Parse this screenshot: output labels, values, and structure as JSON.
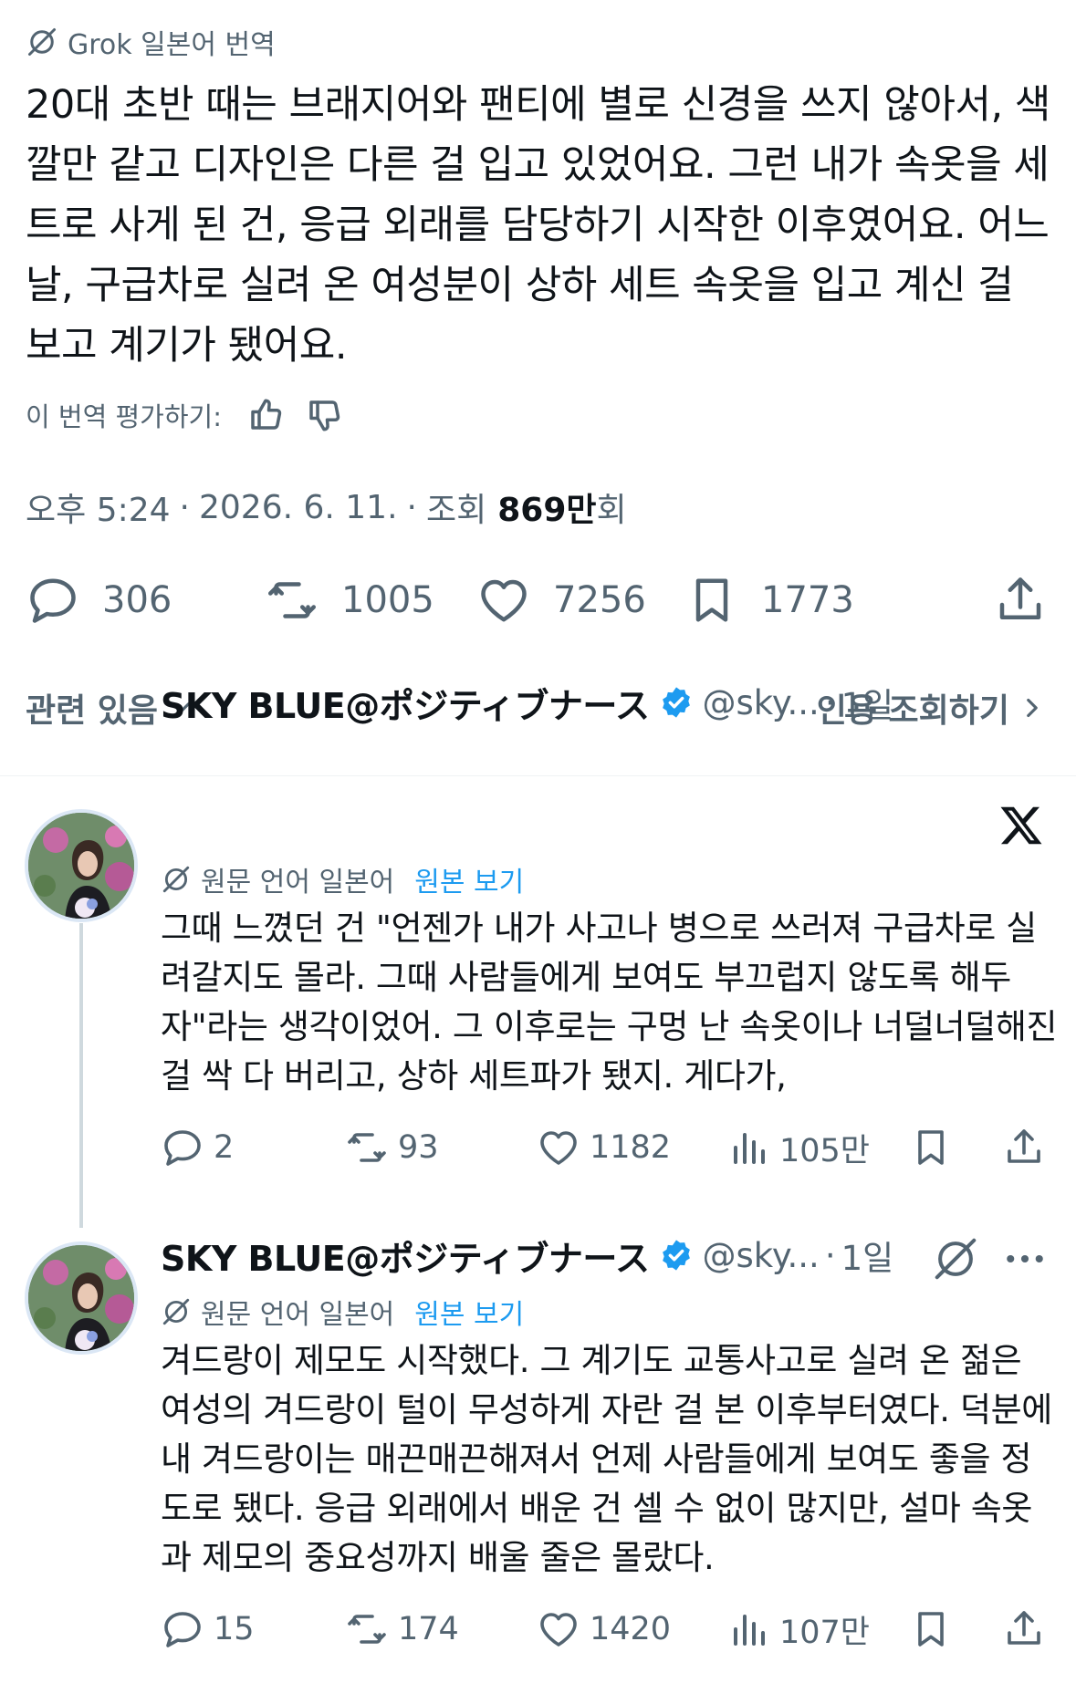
{
  "translation": {
    "label": "Grok 일본어 번역",
    "text": "20대 초반 때는 브래지어와 팬티에 별로 신경을 쓰지 않아서, 색깔만 같고 디자인은 다른 걸 입고 있었어요. 그런 내가 속옷을 세트로 사게 된 건, 응급 외래를 담당하기 시작한 이후였어요. 어느 날, 구급차로 실려 온 여성분이 상하 세트 속옷을 입고 계신 걸 보고 계기가 됐어요.",
    "rate_label": "이 번역 평가하기:"
  },
  "meta": {
    "time": "오후 5:24",
    "date": "2026. 6. 11.",
    "views_prefix": "조회",
    "views_num": "869만",
    "views_suffix": "회"
  },
  "actions": {
    "replies": "306",
    "reposts": "1005",
    "likes": "7256",
    "bookmarks": "1773"
  },
  "related": {
    "left_label": "관련 있음",
    "right_label": "인용 조회하기"
  },
  "replies": [
    {
      "name": "SKY BLUE@ポジティブナース",
      "handle": "@sky...",
      "time": "1일",
      "original_lang": "원문 언어 일본어",
      "view_original": "원본 보기",
      "text": "그때 느꼈던 건 \"언젠가 내가 사고나 병으로 쓰러져 구급차로 실려갈지도 몰라. 그때 사람들에게 보여도 부끄럽지 않도록 해두자\"라는 생각이었어. 그 이후로는 구멍 난 속옷이나 너덜너덜해진 걸 싹 다 버리고, 상하 세트파가 됐지. 게다가,",
      "replies": "2",
      "reposts": "93",
      "likes": "1182",
      "views": "105만",
      "corner_icon": "x-logo-icon"
    },
    {
      "name": "SKY BLUE@ポジティブナース",
      "handle": "@sky...",
      "time": "1일",
      "original_lang": "원문 언어 일본어",
      "view_original": "원본 보기",
      "text": "겨드랑이 제모도 시작했다. 그 계기도 교통사고로 실려 온 젊은 여성의 겨드랑이 털이 무성하게 자란 걸 본 이후부터였다. 덕분에 내 겨드랑이는 매끈매끈해져서 언제 사람들에게 보여도 좋을 정도로 됐다. 응급 외래에서 배운 건 셀 수 없이 많지만, 설마 속옷과 제모의 중요성까지 배울 줄은 몰랐다.",
      "replies": "15",
      "reposts": "174",
      "likes": "1420",
      "views": "107만",
      "corner_icon": "grok-icon"
    }
  ],
  "colors": {
    "text": "#0f1419",
    "secondary": "#536471",
    "link": "#1d9bf0",
    "verified": "#1d9bf0"
  }
}
